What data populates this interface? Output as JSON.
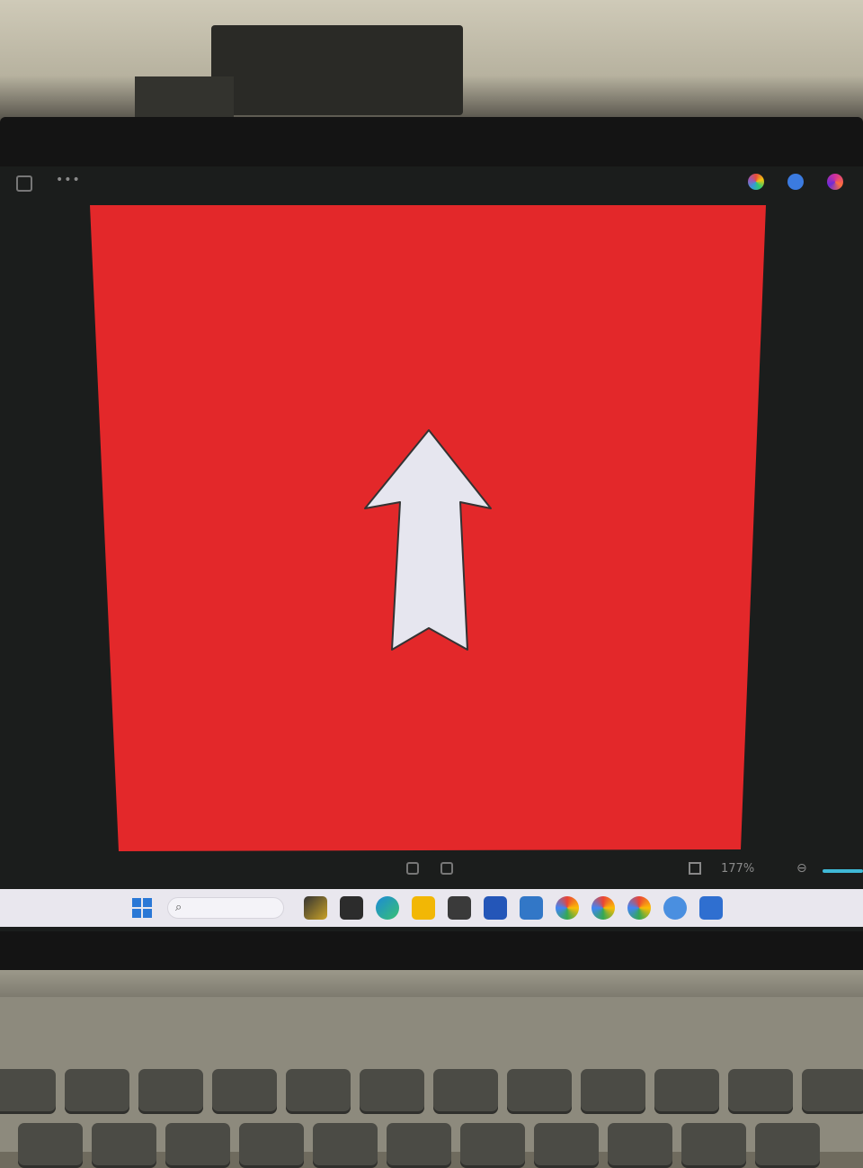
{
  "window": {
    "title": "",
    "toolbar_icons": [
      "window-menu-icon",
      "more-dots-icon"
    ],
    "pinned_apps": [
      "colorful-app-icon",
      "blue-app-icon",
      "pink-app-icon"
    ]
  },
  "image": {
    "background_color": "#e3282a",
    "arrow_color": "#e6e6ef",
    "arrow_outline": "#333333",
    "arrow_direction": "up"
  },
  "status": {
    "left_text": "",
    "zoom": "177%"
  },
  "taskbar": {
    "search_placeholder": "",
    "apps": [
      "file-explorer",
      "terminal",
      "edge",
      "folder",
      "media",
      "store",
      "vscode",
      "chrome",
      "chrome-profile-2",
      "chrome-profile-3",
      "settings",
      "app"
    ]
  },
  "colors": {
    "accent": "#3fb9d6",
    "bezel": "#141414",
    "taskbar": "#e9e7ee"
  }
}
